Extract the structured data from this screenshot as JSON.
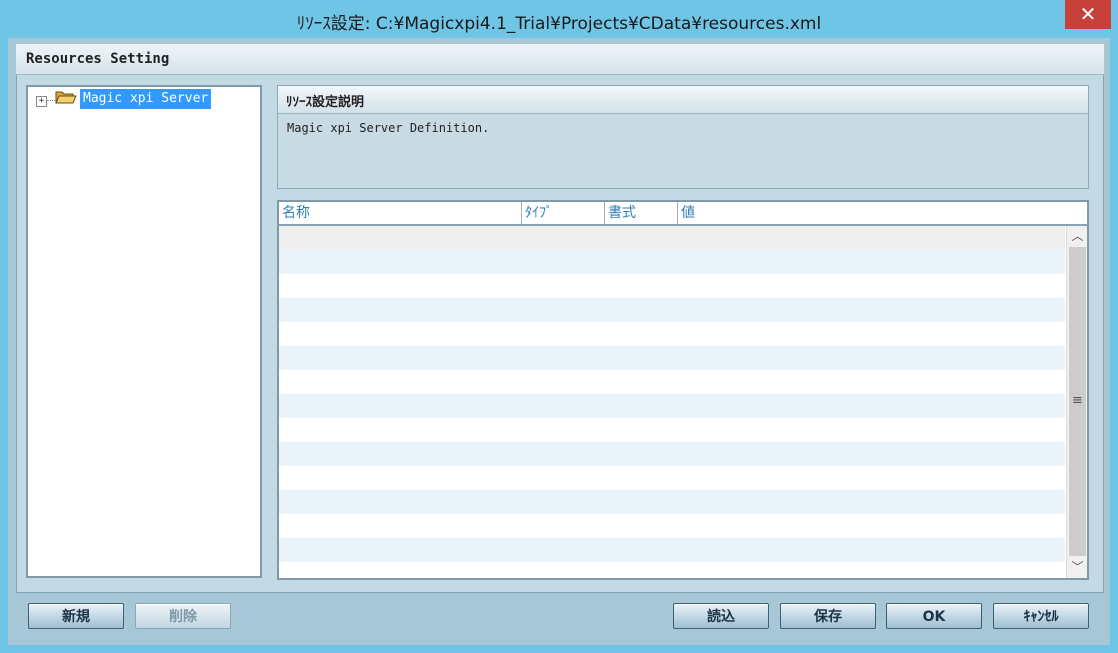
{
  "window": {
    "title": "ﾘｿｰｽ設定: C:¥Magicxpi4.1_Trial¥Projects¥CData¥resources.xml",
    "close_glyph": "✕"
  },
  "section_header": "Resources Setting",
  "tree": {
    "expander": "+",
    "items": [
      {
        "label": "Magic xpi Server",
        "selected": true
      }
    ]
  },
  "description": {
    "title": "ﾘｿｰｽ設定説明",
    "text": "Magic xpi Server Definition."
  },
  "grid": {
    "columns": [
      "名称",
      "ﾀｲﾌﾟ",
      "書式",
      "値"
    ],
    "row_count": 15
  },
  "scrollbar": {
    "up_glyph": "︿",
    "down_glyph": "﹀",
    "grip_glyph": "≡"
  },
  "buttons": {
    "new": "新規",
    "delete": "削除",
    "load": "読込",
    "save": "保存",
    "ok": "OK",
    "cancel": "ｷｬﾝｾﾙ"
  },
  "colors": {
    "titlebar": "#6fc5e6",
    "close": "#c7413a",
    "selection": "#3399ff",
    "column_header_text": "#2f7fb6"
  },
  "icons": {
    "tree_node": "open-folder-icon"
  }
}
